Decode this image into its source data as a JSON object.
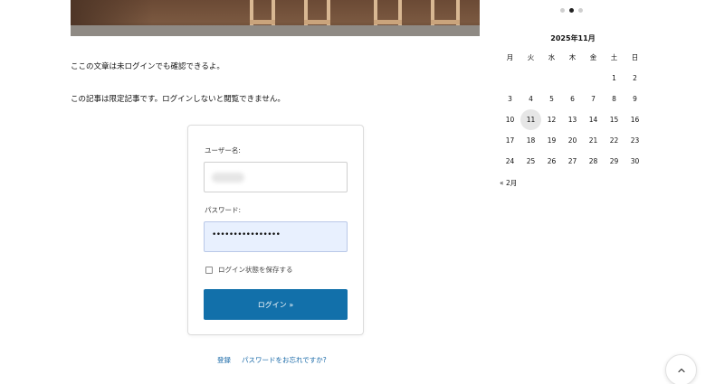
{
  "content": {
    "paragraph_public": "ここの文章は未ログインでも確認できるよ。",
    "paragraph_restricted": "この記事は限定記事です。ログインしないと閲覧できません。"
  },
  "login_form": {
    "username_label": "ユーザー名:",
    "username_value": "",
    "password_label": "パスワード:",
    "password_value": "••••••••••••••••",
    "remember_label": "ログイン状態を保存する",
    "remember_checked": false,
    "submit_label": "ログイン »",
    "submit_color": "#1270aa"
  },
  "links": {
    "register": "登録",
    "lost_password": "パスワードをお忘れですか?"
  },
  "slider": {
    "dot_count": 3,
    "active_index": 1
  },
  "calendar": {
    "title": "2025年11月",
    "weekdays": [
      "月",
      "火",
      "水",
      "木",
      "金",
      "土",
      "日"
    ],
    "weeks": [
      [
        "",
        "",
        "",
        "",
        "",
        "1",
        "2"
      ],
      [
        "3",
        "4",
        "5",
        "6",
        "7",
        "8",
        "9"
      ],
      [
        "10",
        "11",
        "12",
        "13",
        "14",
        "15",
        "16"
      ],
      [
        "17",
        "18",
        "19",
        "20",
        "21",
        "22",
        "23"
      ],
      [
        "24",
        "25",
        "26",
        "27",
        "28",
        "29",
        "30"
      ]
    ],
    "today": "11",
    "prev_link": "« 2月"
  },
  "back_to_top_icon": "chevron-up-icon"
}
